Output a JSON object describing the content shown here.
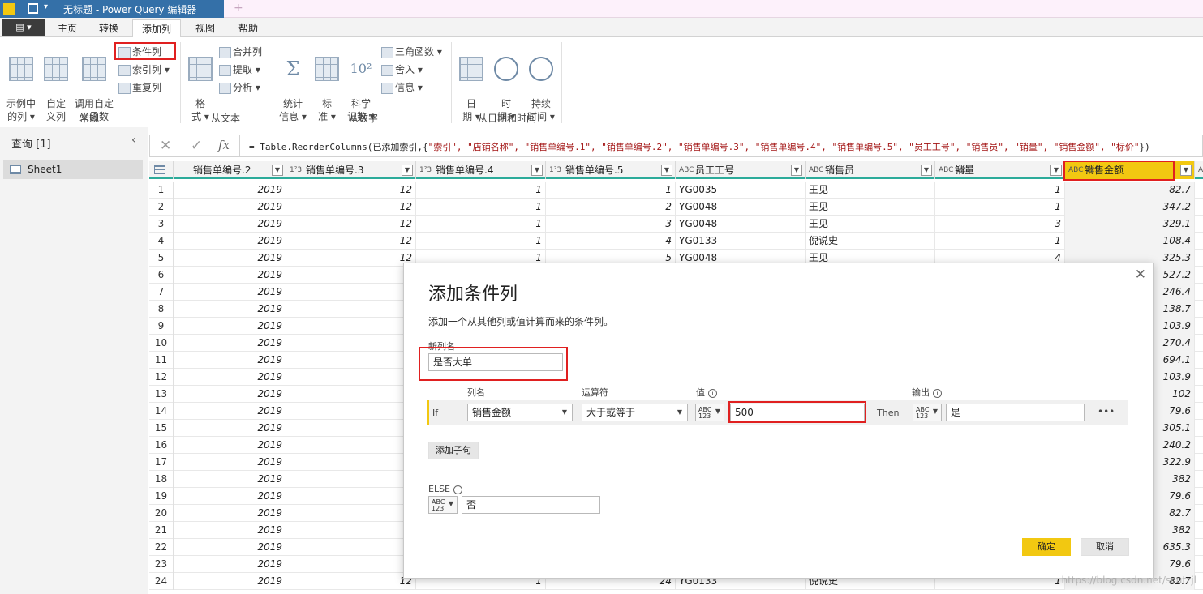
{
  "titlebar": {
    "quick_access": "▾",
    "title": "无标题 - Power Query 编辑器",
    "new_tab": "+"
  },
  "menu": {
    "file": "▤ ▾",
    "tabs": [
      "主页",
      "转换",
      "添加列",
      "视图",
      "帮助"
    ],
    "active": "添加列"
  },
  "ribbon": {
    "groups": {
      "general": {
        "label": "常规",
        "example_col": "示例中\n的列 ▾",
        "custom_col": "自定\n义列",
        "invoke_fn": "调用自定\n义函数",
        "conditional": "条件列",
        "index": "索引列 ▾",
        "duplicate": "重复列"
      },
      "text": {
        "label": "从文本",
        "format": "格\n式 ▾",
        "merge": "合并列",
        "extract": "提取 ▾",
        "parse": "分析 ▾"
      },
      "number": {
        "label": "从数字",
        "stats": "统计\n信息 ▾",
        "standard": "标\n准 ▾",
        "scientific": "科学\n记数 ▾",
        "trig": "三角函数 ▾",
        "round": "舍入 ▾",
        "info": "信息 ▾"
      },
      "datetime": {
        "label": "从日期和时间",
        "date": "日\n期 ▾",
        "time": "时\n间 ▾",
        "duration": "持续\n时间 ▾"
      }
    }
  },
  "queries": {
    "title": "查询 [1]",
    "collapse": "‹",
    "items": [
      "Sheet1"
    ]
  },
  "formula": {
    "cancel": "✕",
    "confirm": "✓",
    "fx": "fx",
    "prefix": "= Table.ReorderColumns(已添加索引,{",
    "strings": "\"索引\", \"店铺名称\", \"销售单编号.1\", \"销售单编号.2\", \"销售单编号.3\", \"销售单编号.4\", \"销售单编号.5\", \"员工工号\", \"销售员\", \"销量\", \"销售金额\", \"标价\"",
    "suffix": "})"
  },
  "grid": {
    "columns": [
      {
        "name": "销售单编号.2",
        "type": ""
      },
      {
        "name": "销售单编号.3",
        "type": "1²3"
      },
      {
        "name": "销售单编号.4",
        "type": "1²3"
      },
      {
        "name": "销售单编号.5",
        "type": "1²3"
      },
      {
        "name": "员工工号",
        "type": "ABC"
      },
      {
        "name": "销售员",
        "type": "ABC"
      },
      {
        "name": "销量",
        "type": "ABC 123"
      },
      {
        "name": "销售金额",
        "type": "ABC 123"
      },
      {
        "name": "",
        "type": "ABC 12"
      }
    ],
    "rows": [
      [
        "1",
        "2019",
        "12",
        "1",
        "1",
        "YG0035",
        "王见",
        "1",
        "82.7"
      ],
      [
        "2",
        "2019",
        "12",
        "1",
        "2",
        "YG0048",
        "王见",
        "1",
        "347.2"
      ],
      [
        "3",
        "2019",
        "12",
        "1",
        "3",
        "YG0048",
        "王见",
        "3",
        "329.1"
      ],
      [
        "4",
        "2019",
        "12",
        "1",
        "4",
        "YG0133",
        "倪说史",
        "1",
        "108.4"
      ],
      [
        "5",
        "2019",
        "12",
        "1",
        "5",
        "YG0048",
        "王见",
        "4",
        "325.3"
      ],
      [
        "6",
        "2019",
        "",
        "",
        "",
        "",
        "",
        "",
        "527.2"
      ],
      [
        "7",
        "2019",
        "",
        "",
        "",
        "",
        "",
        "",
        "246.4"
      ],
      [
        "8",
        "2019",
        "",
        "",
        "",
        "",
        "",
        "",
        "138.7"
      ],
      [
        "9",
        "2019",
        "",
        "",
        "",
        "",
        "",
        "",
        "103.9"
      ],
      [
        "10",
        "2019",
        "",
        "",
        "",
        "",
        "",
        "",
        "270.4"
      ],
      [
        "11",
        "2019",
        "",
        "",
        "",
        "",
        "",
        "",
        "694.1"
      ],
      [
        "12",
        "2019",
        "",
        "",
        "",
        "",
        "",
        "",
        "103.9"
      ],
      [
        "13",
        "2019",
        "",
        "",
        "",
        "",
        "",
        "",
        "102"
      ],
      [
        "14",
        "2019",
        "",
        "",
        "",
        "",
        "",
        "",
        "79.6"
      ],
      [
        "15",
        "2019",
        "",
        "",
        "",
        "",
        "",
        "",
        "305.1"
      ],
      [
        "16",
        "2019",
        "",
        "",
        "",
        "",
        "",
        "",
        "240.2"
      ],
      [
        "17",
        "2019",
        "",
        "",
        "",
        "",
        "",
        "",
        "322.9"
      ],
      [
        "18",
        "2019",
        "",
        "",
        "",
        "",
        "",
        "",
        "382"
      ],
      [
        "19",
        "2019",
        "",
        "",
        "",
        "",
        "",
        "",
        "79.6"
      ],
      [
        "20",
        "2019",
        "",
        "",
        "",
        "",
        "",
        "",
        "82.7"
      ],
      [
        "21",
        "2019",
        "",
        "",
        "",
        "",
        "",
        "",
        "382"
      ],
      [
        "22",
        "2019",
        "",
        "",
        "",
        "",
        "",
        "",
        "635.3"
      ],
      [
        "23",
        "2019",
        "",
        "",
        "",
        "",
        "",
        "",
        "79.6"
      ],
      [
        "24",
        "2019",
        "12",
        "1",
        "24",
        "YG0133",
        "倪说史",
        "1",
        "82.7"
      ]
    ]
  },
  "dialog": {
    "close": "✕",
    "title": "添加条件列",
    "subtitle": "添加一个从其他列或值计算而来的条件列。",
    "new_col_label": "新列名",
    "new_col_value": "是否大单",
    "headers": {
      "column": "列名",
      "operator": "运算符",
      "value": "值",
      "output": "输出"
    },
    "if_label": "If",
    "column_value": "销售金额",
    "operator_value": "大于或等于",
    "value": "500",
    "then_label": "Then",
    "output_value": "是",
    "more": "•••",
    "add_clause": "添加子句",
    "else_label": "ELSE",
    "else_value": "否",
    "type_icon": "ABC\n123",
    "info_icon": "i",
    "ok": "确定",
    "cancel": "取消"
  },
  "watermark": "https://blog.csdn.net/scutzjl"
}
